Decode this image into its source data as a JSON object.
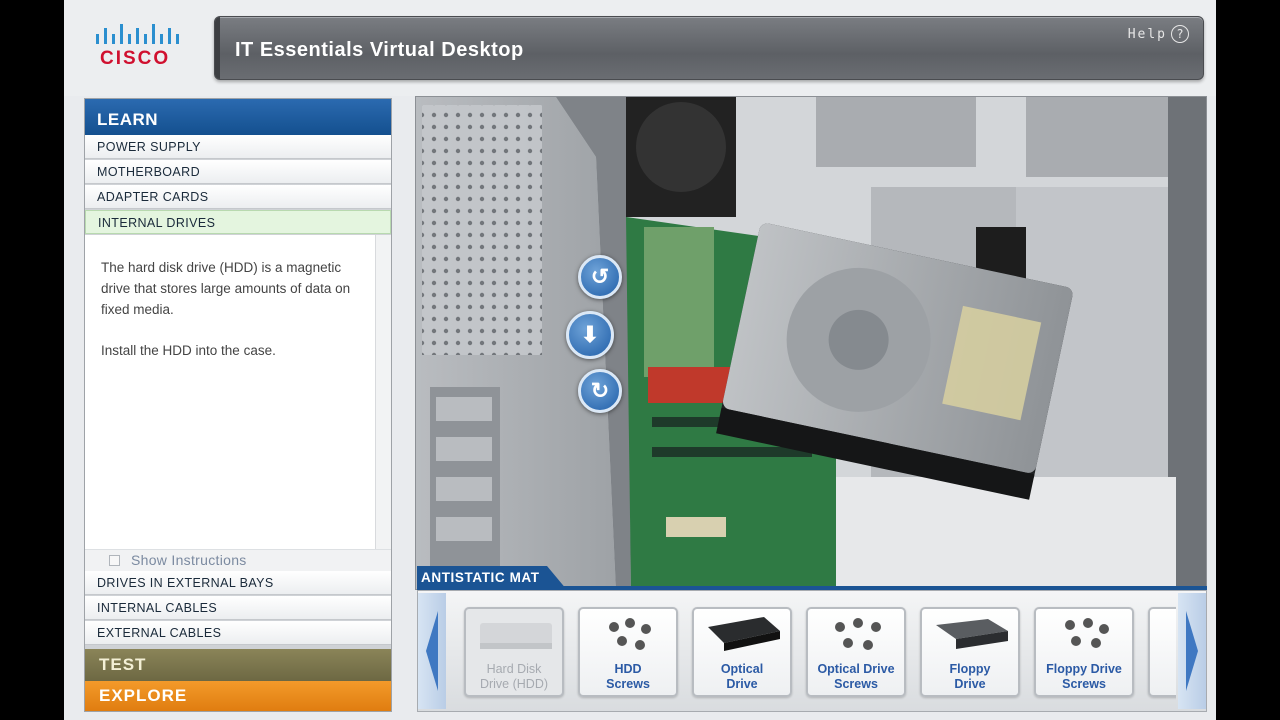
{
  "header": {
    "logo_text": "CISCO",
    "title": "IT Essentials Virtual Desktop",
    "help_label": "Help",
    "help_icon_glyph": "?"
  },
  "sidebar": {
    "learn_label": "LEARN",
    "items_top": [
      {
        "label": "POWER SUPPLY"
      },
      {
        "label": "MOTHERBOARD"
      },
      {
        "label": "ADAPTER CARDS"
      },
      {
        "label": "INTERNAL DRIVES",
        "active": true
      }
    ],
    "content": {
      "paragraph1": "The hard disk drive (HDD) is a magnetic drive that stores large amounts of data on fixed media.",
      "paragraph2": "Install the HDD into the case."
    },
    "show_instructions_label": "Show Instructions",
    "items_bottom": [
      {
        "label": "DRIVES IN EXTERNAL BAYS"
      },
      {
        "label": "INTERNAL CABLES"
      },
      {
        "label": "EXTERNAL CABLES"
      }
    ],
    "test_label": "TEST",
    "explore_label": "EXPLORE"
  },
  "viewport": {
    "controls": [
      {
        "name": "rotate-left",
        "glyph": "↺"
      },
      {
        "name": "install-down",
        "glyph": "⬇"
      },
      {
        "name": "rotate-right",
        "glyph": "↻"
      }
    ]
  },
  "tray": {
    "label": "ANTISTATIC MAT",
    "items": [
      {
        "line1": "Hard Disk",
        "line2": "Drive (HDD)",
        "disabled": true,
        "icon": "hdd-icon"
      },
      {
        "line1": "HDD",
        "line2": "Screws",
        "icon": "screws-icon"
      },
      {
        "line1": "Optical",
        "line2": "Drive",
        "icon": "optical-drive-icon"
      },
      {
        "line1": "Optical Drive",
        "line2": "Screws",
        "icon": "screws-icon"
      },
      {
        "line1": "Floppy",
        "line2": "Drive",
        "icon": "floppy-drive-icon"
      },
      {
        "line1": "Floppy Drive",
        "line2": "Screws",
        "icon": "screws-icon"
      }
    ]
  },
  "colors": {
    "learn_blue": "#1b5494",
    "test_olive": "#7a7450",
    "explore_orange": "#ef8b1c",
    "item_label_blue": "#2b5aa5"
  }
}
